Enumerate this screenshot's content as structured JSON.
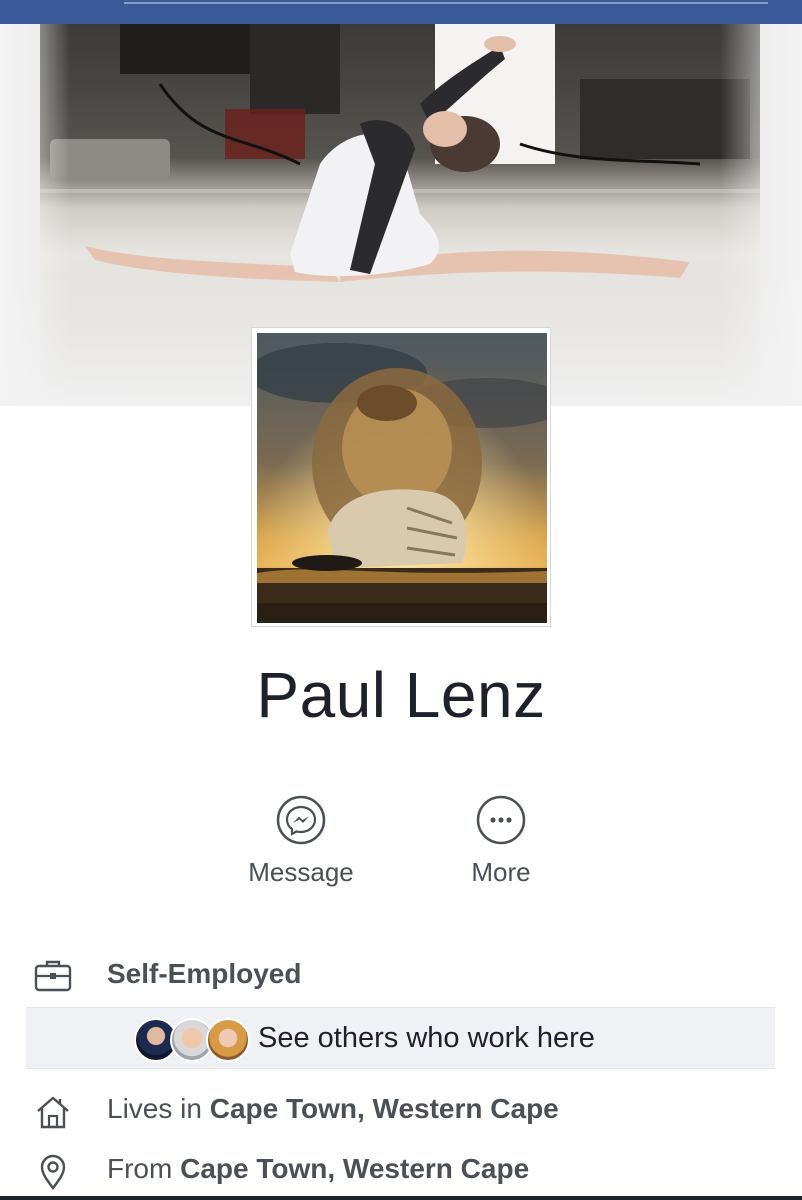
{
  "profile": {
    "name": "Paul Lenz"
  },
  "actions": {
    "message_label": "Message",
    "more_label": "More",
    "message_icon": "messenger-icon",
    "more_icon": "ellipsis-icon"
  },
  "intro": {
    "work": {
      "icon": "briefcase-icon",
      "label": "Self-Employed",
      "coworkers_text": "See others who work here"
    },
    "lives_in": {
      "icon": "home-icon",
      "prefix": "Lives in",
      "place": "Cape Town, Western Cape"
    },
    "from": {
      "icon": "location-pin-icon",
      "prefix": "From",
      "place": "Cape Town, Western Cape"
    }
  },
  "colors": {
    "brand_blue": "#3b5998",
    "text_dark": "#1d2129",
    "text_secondary": "#4b4f56",
    "row_highlight": "#f0f1f4"
  }
}
